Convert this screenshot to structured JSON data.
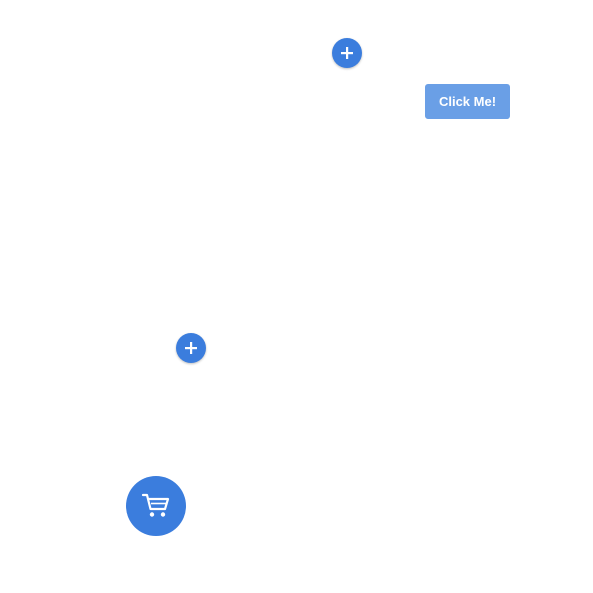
{
  "buttons": {
    "click_me_label": "Click Me!"
  },
  "icons": {
    "add_top": "plus-icon",
    "add_middle": "plus-icon",
    "cart": "shopping-cart-icon"
  },
  "colors": {
    "primary": "#3b7ddd",
    "button_light": "#6a9fe6",
    "background": "#ffffff"
  }
}
